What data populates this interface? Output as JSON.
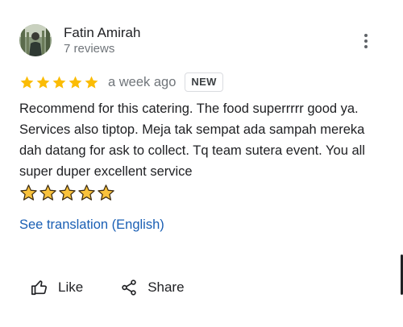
{
  "review": {
    "author_name": "Fatin Amirah",
    "author_meta": "7 reviews",
    "avatar": "profile-photo",
    "rating": 5,
    "rating_max": 5,
    "date": "a week ago",
    "badge": "NEW",
    "text": "Recommend for this catering. The food superrrrr good ya. Services also tiptop. Meja tak sempat ada sampah mereka dah datang for ask to collect. Tq team sutera event. You all super duper excellent service",
    "text_emoji": "⭐⭐⭐⭐⭐",
    "translate_label": "See translation (English)"
  },
  "actions": {
    "like_label": "Like",
    "share_label": "Share"
  },
  "colors": {
    "star": "#fbbc04",
    "link": "#1a5fb4",
    "muted": "#70757a",
    "text": "#202124"
  },
  "icons": [
    "more-vert-icon",
    "star-icon",
    "thumb-up-icon",
    "share-icon"
  ]
}
